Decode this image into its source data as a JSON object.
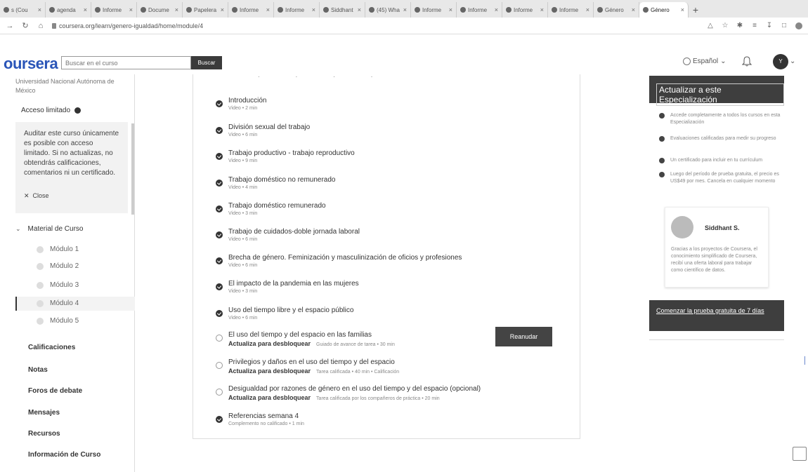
{
  "browser": {
    "tabs": [
      {
        "label": "s (Cou"
      },
      {
        "label": "agenda"
      },
      {
        "label": "Informe"
      },
      {
        "label": "Docume"
      },
      {
        "label": "Papelera"
      },
      {
        "label": "Informe"
      },
      {
        "label": "Informe"
      },
      {
        "label": "Siddhant"
      },
      {
        "label": "(45) Wha"
      },
      {
        "label": "Informe"
      },
      {
        "label": "Informe"
      },
      {
        "label": "Informe"
      },
      {
        "label": "Informe"
      },
      {
        "label": "Género"
      },
      {
        "label": "Género"
      }
    ],
    "new_tab": "+",
    "url": "coursera.org/learn/genero-igualdad/home/module/4"
  },
  "header": {
    "logo": "oursera",
    "search_placeholder": "Buscar en el curso",
    "search_button": "Buscar",
    "language": "Español",
    "avatar_initial": "Y"
  },
  "sidebar": {
    "university": "Universidad Nacional Autónoma de México",
    "access_label": "Acceso limitado",
    "audit_text": "Auditar este curso únicamente es posible con acceso limitado. Si no actualizas, no obtendrás calificaciones, comentarios ni un certificado.",
    "close_label": "Close",
    "material_label": "Material de Curso",
    "modules": [
      "Módulo 1",
      "Módulo 2",
      "Módulo 3",
      "Módulo 4",
      "Módulo 5"
    ],
    "nav_links": [
      "Calificaciones",
      "Notas",
      "Foros de debate",
      "Mensajes",
      "Recursos",
      "Información de Curso"
    ]
  },
  "lessons": [
    {
      "title": "Introducción",
      "meta": "Video • 2 min",
      "locked": false
    },
    {
      "title": "División sexual del trabajo",
      "meta": "Video • 6 min",
      "locked": false
    },
    {
      "title": "Trabajo productivo - trabajo reproductivo",
      "meta": "Video • 9 min",
      "locked": false
    },
    {
      "title": "Trabajo doméstico no remunerado",
      "meta": "Video • 4 min",
      "locked": false
    },
    {
      "title": "Trabajo doméstico remunerado",
      "meta": "Video • 3 min",
      "locked": false
    },
    {
      "title": "Trabajo de cuidados-doble jornada laboral",
      "meta": "Video • 6 min",
      "locked": false
    },
    {
      "title": "Brecha de género. Feminización y masculinización de oficios y profesiones",
      "meta": "Video • 6 min",
      "locked": false
    },
    {
      "title": "El impacto de la pandemia en las mujeres",
      "meta": "Video • 3 min",
      "locked": false
    },
    {
      "title": "Uso del tiempo libre y el espacio público",
      "meta": "Video • 6 min",
      "locked": false
    },
    {
      "title": "El uso del tiempo y del espacio en las familias",
      "unlock": "Actualiza para desbloquear",
      "meta": "Guiado de avance de tarea • 30 min",
      "locked": true
    },
    {
      "title": "Privilegios y daños en el uso del tiempo y del espacio",
      "unlock": "Actualiza para desbloquear",
      "meta": "Tarea calificada • 40 min • Calificación",
      "locked": true
    },
    {
      "title": "Desigualdad por razones de género en el uso del tiempo y del espacio (opcional)",
      "unlock": "Actualiza para desbloquear",
      "meta": "Tarea calificada por los compañeros de práctica • 20 min",
      "locked": true
    },
    {
      "title": "Referencias semana 4",
      "meta": "Complemento no calificado • 1 min",
      "locked": false
    }
  ],
  "resume_button": "Reanudar",
  "upgrade": {
    "title": "Actualizar a este Especialización",
    "benefits": [
      "Accede completamente a todos los cursos en esta Especialización",
      "Evaluaciones calificadas para medir su progreso",
      "Un certificado para incluir en tu currículum",
      "Luego del período de prueba gratuita, el precio es US$49 por mes. Cancela en cualquier momento"
    ],
    "instructor_name": "Siddhant S.",
    "instructor_quote": "Gracias a los proyectos de Coursera, el conocimiento simplificado de Coursera, recibí una oferta laboral para trabajar como científico de datos.",
    "trial_button": "Comenzar la prueba gratuita de 7 días"
  }
}
